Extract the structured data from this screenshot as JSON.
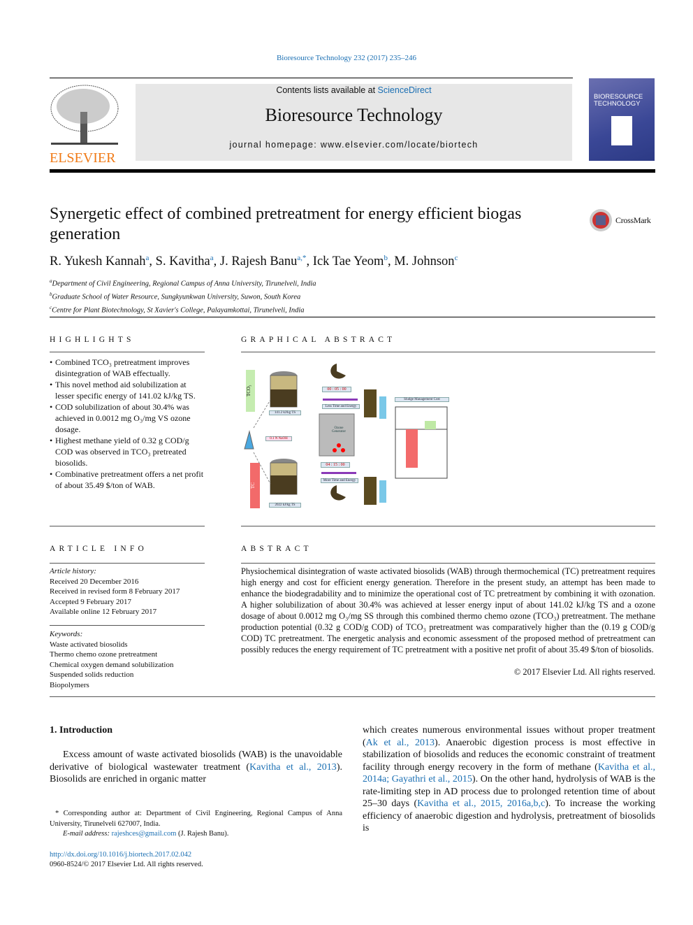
{
  "journal_ref": "Bioresource Technology 232 (2017) 235–246",
  "header": {
    "contents_prefix": "Contents lists available at ",
    "contents_link": "ScienceDirect",
    "journal_title": "Bioresource Technology",
    "homepage": "journal homepage: www.elsevier.com/locate/biortech",
    "publisher_logo": "ELSEVIER",
    "cover_text": "BIORESOURCE TECHNOLOGY"
  },
  "article": {
    "title": "Synergetic effect of combined pretreatment for energy efficient biogas generation",
    "crossmark": "CrossMark",
    "authors": [
      {
        "name": "R. Yukesh Kannah",
        "sup": "a"
      },
      {
        "name": "S. Kavitha",
        "sup": "a"
      },
      {
        "name": "J. Rajesh Banu",
        "sup": "a,*"
      },
      {
        "name": "Ick Tae Yeom",
        "sup": "b"
      },
      {
        "name": "M. Johnson",
        "sup": "c"
      }
    ],
    "affiliations": [
      {
        "sup": "a",
        "text": "Department of Civil Engineering, Regional Campus of Anna University, Tirunelveli, India"
      },
      {
        "sup": "b",
        "text": "Graduate School of Water Resource, Sungkyunkwan University, Suwon, South Korea"
      },
      {
        "sup": "c",
        "text": "Centre for Plant Biotechnology, St Xavier's College, Palayamkottai, Tirunelveli, India"
      }
    ]
  },
  "highlights": {
    "heading": "HIGHLIGHTS",
    "items": [
      "Combined TCO₃ pretreatment improves disintegration of WAB effectually.",
      "This novel method aid solubilization at lesser specific energy of 141.02 kJ/kg TS.",
      "COD solubilization of about 30.4% was achieved in 0.0012 mg O₃/mg VS ozone dosage.",
      "Highest methane yield of 0.32 g COD/g COD was observed in TCO₃ pretreated biosolids.",
      "Combinative pretreatment offers a net profit of about 35.49 $/ton of WAB."
    ]
  },
  "graphical_abstract": {
    "heading": "GRAPHICAL ABSTRACT",
    "tco3": "TCO₃",
    "tc": "TC",
    "energy_tco3": "141.2 kJ/kg TS",
    "energy_tc": "2022 kJ/kg TS",
    "naoh": "0.1 N NaOH",
    "timer_tco3": "00 : 05 : 00",
    "timer_tc": "04 : 15 : 00",
    "less": "Less Time and Energy",
    "more": "More Time and Energy",
    "ozone": "Ozone Generator",
    "cost_title": "Sludge Management Cost"
  },
  "article_info": {
    "heading": "ARTICLE INFO",
    "history_label": "Article history:",
    "history": [
      "Received 20 December 2016",
      "Received in revised form 8 February 2017",
      "Accepted 9 February 2017",
      "Available online 12 February 2017"
    ],
    "keywords_label": "Keywords:",
    "keywords": [
      "Waste activated biosolids",
      "Thermo chemo ozone pretreatment",
      "Chemical oxygen demand solubilization",
      "Suspended solids reduction",
      "Biopolymers"
    ]
  },
  "abstract": {
    "heading": "ABSTRACT",
    "text": "Physiochemical disintegration of waste activated biosolids (WAB) through thermochemical (TC) pretreatment requires high energy and cost for efficient energy generation. Therefore in the present study, an attempt has been made to enhance the biodegradability and to minimize the operational cost of TC pretreatment by combining it with ozonation. A higher solubilization of about 30.4% was achieved at lesser energy input of about 141.02 kJ/kg TS and a ozone dosage of about 0.0012 mg O₃/mg SS through this combined thermo chemo ozone (TCO₃) pretreatment. The methane production potential (0.32 g COD/g COD) of TCO₃ pretreatment was comparatively higher than the (0.19 g COD/g COD) TC pretreatment. The energetic analysis and economic assessment of the proposed method of pretreatment can possibly reduces the energy requirement of TC pretreatment with a positive net profit of about 35.49 $/ton of biosolids.",
    "copyright": "© 2017 Elsevier Ltd. All rights reserved."
  },
  "intro": {
    "heading": "1. Introduction",
    "p1": {
      "t1": "Excess amount of waste activated biosolids (WAB) is the unavoidable derivative of biological wastewater treatment (",
      "c1": "Kavitha et al., 2013",
      "t2": "). Biosolids are enriched in organic matter"
    },
    "p2": {
      "t1": "which creates numerous environmental issues without proper treatment (",
      "c1": "Ak et al., 2013",
      "t2": "). Anaerobic digestion process is most effective in stabilization of biosolids and reduces the economic constraint of treatment facility through energy recovery in the form of methane (",
      "c2": "Kavitha et al., 2014a; Gayathri et al., 2015",
      "t3": "). On the other hand, hydrolysis of WAB is the rate-limiting step in AD process due to prolonged retention time of about 25–30 days (",
      "c3": "Kavitha et al., 2015, 2016a,b,c",
      "t4": "). To increase the working efficiency of anaerobic digestion and hydrolysis, pretreatment of biosolids is"
    }
  },
  "footnote": {
    "corresponding": "* Corresponding author at: Department of Civil Engineering, Regional Campus of Anna University, Tirunelveli 627007, India.",
    "email_label": "E-mail address: ",
    "email": "rajeshces@gmail.com",
    "email_suffix": " (J. Rajesh Banu)."
  },
  "doi": "http://dx.doi.org/10.1016/j.biortech.2017.02.042",
  "issn": "0960-8524/© 2017 Elsevier Ltd. All rights reserved."
}
